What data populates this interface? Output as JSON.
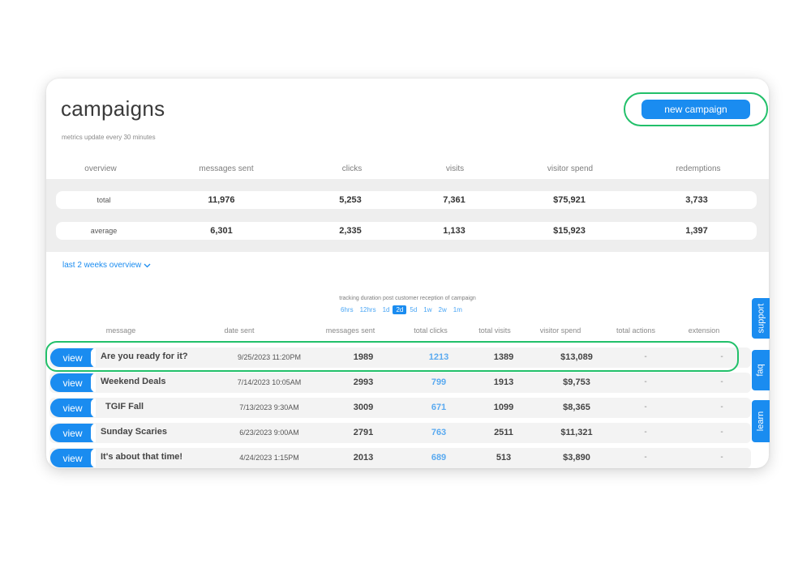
{
  "header": {
    "title": "campaigns",
    "subtitle": "metrics update every 30 minutes",
    "new_campaign_label": "new campaign"
  },
  "overview": {
    "columns": [
      "overview",
      "messages sent",
      "clicks",
      "visits",
      "visitor spend",
      "redemptions"
    ],
    "rows": [
      {
        "label": "total",
        "messages_sent": "11,976",
        "clicks": "5,253",
        "visits": "7,361",
        "visitor_spend": "$75,921",
        "redemptions": "3,733"
      },
      {
        "label": "average",
        "messages_sent": "6,301",
        "clicks": "2,335",
        "visits": "1,133",
        "visitor_spend": "$15,923",
        "redemptions": "1,397"
      }
    ]
  },
  "trend_link": "last 2 weeks overview",
  "tracking": {
    "label": "tracking duration post customer reception of campaign",
    "options": [
      "6hrs",
      "12hrs",
      "1d",
      "2d",
      "5d",
      "1w",
      "2w",
      "1m"
    ],
    "selected": "2d"
  },
  "table": {
    "columns": [
      "message",
      "date sent",
      "messages sent",
      "total clicks",
      "total visits",
      "visitor spend",
      "total actions",
      "extension"
    ],
    "view_label": "view",
    "rows": [
      {
        "message": "Are you ready for it?",
        "date": "9/25/2023 11:20PM",
        "sent": "1989",
        "clicks": "1213",
        "visits": "1389",
        "spend": "$13,089",
        "actions": "-",
        "extension": "-"
      },
      {
        "message": "Weekend Deals",
        "date": "7/14/2023 10:05AM",
        "sent": "2993",
        "clicks": "799",
        "visits": "1913",
        "spend": "$9,753",
        "actions": "-",
        "extension": "-"
      },
      {
        "message": "TGIF Fall",
        "date": "7/13/2023 9:30AM",
        "sent": "3009",
        "clicks": "671",
        "visits": "1099",
        "spend": "$8,365",
        "actions": "-",
        "extension": "-"
      },
      {
        "message": "Sunday Scaries",
        "date": "6/23/2023 9:00AM",
        "sent": "2791",
        "clicks": "763",
        "visits": "2511",
        "spend": "$11,321",
        "actions": "-",
        "extension": "-"
      },
      {
        "message": "It's about that time!",
        "date": "4/24/2023 1:15PM",
        "sent": "2013",
        "clicks": "689",
        "visits": "513",
        "spend": "$3,890",
        "actions": "-",
        "extension": "-"
      }
    ]
  },
  "side_tabs": [
    "support",
    "faq",
    "learn"
  ],
  "colors": {
    "accent": "#1a8cf0",
    "highlight": "#22c06a"
  }
}
